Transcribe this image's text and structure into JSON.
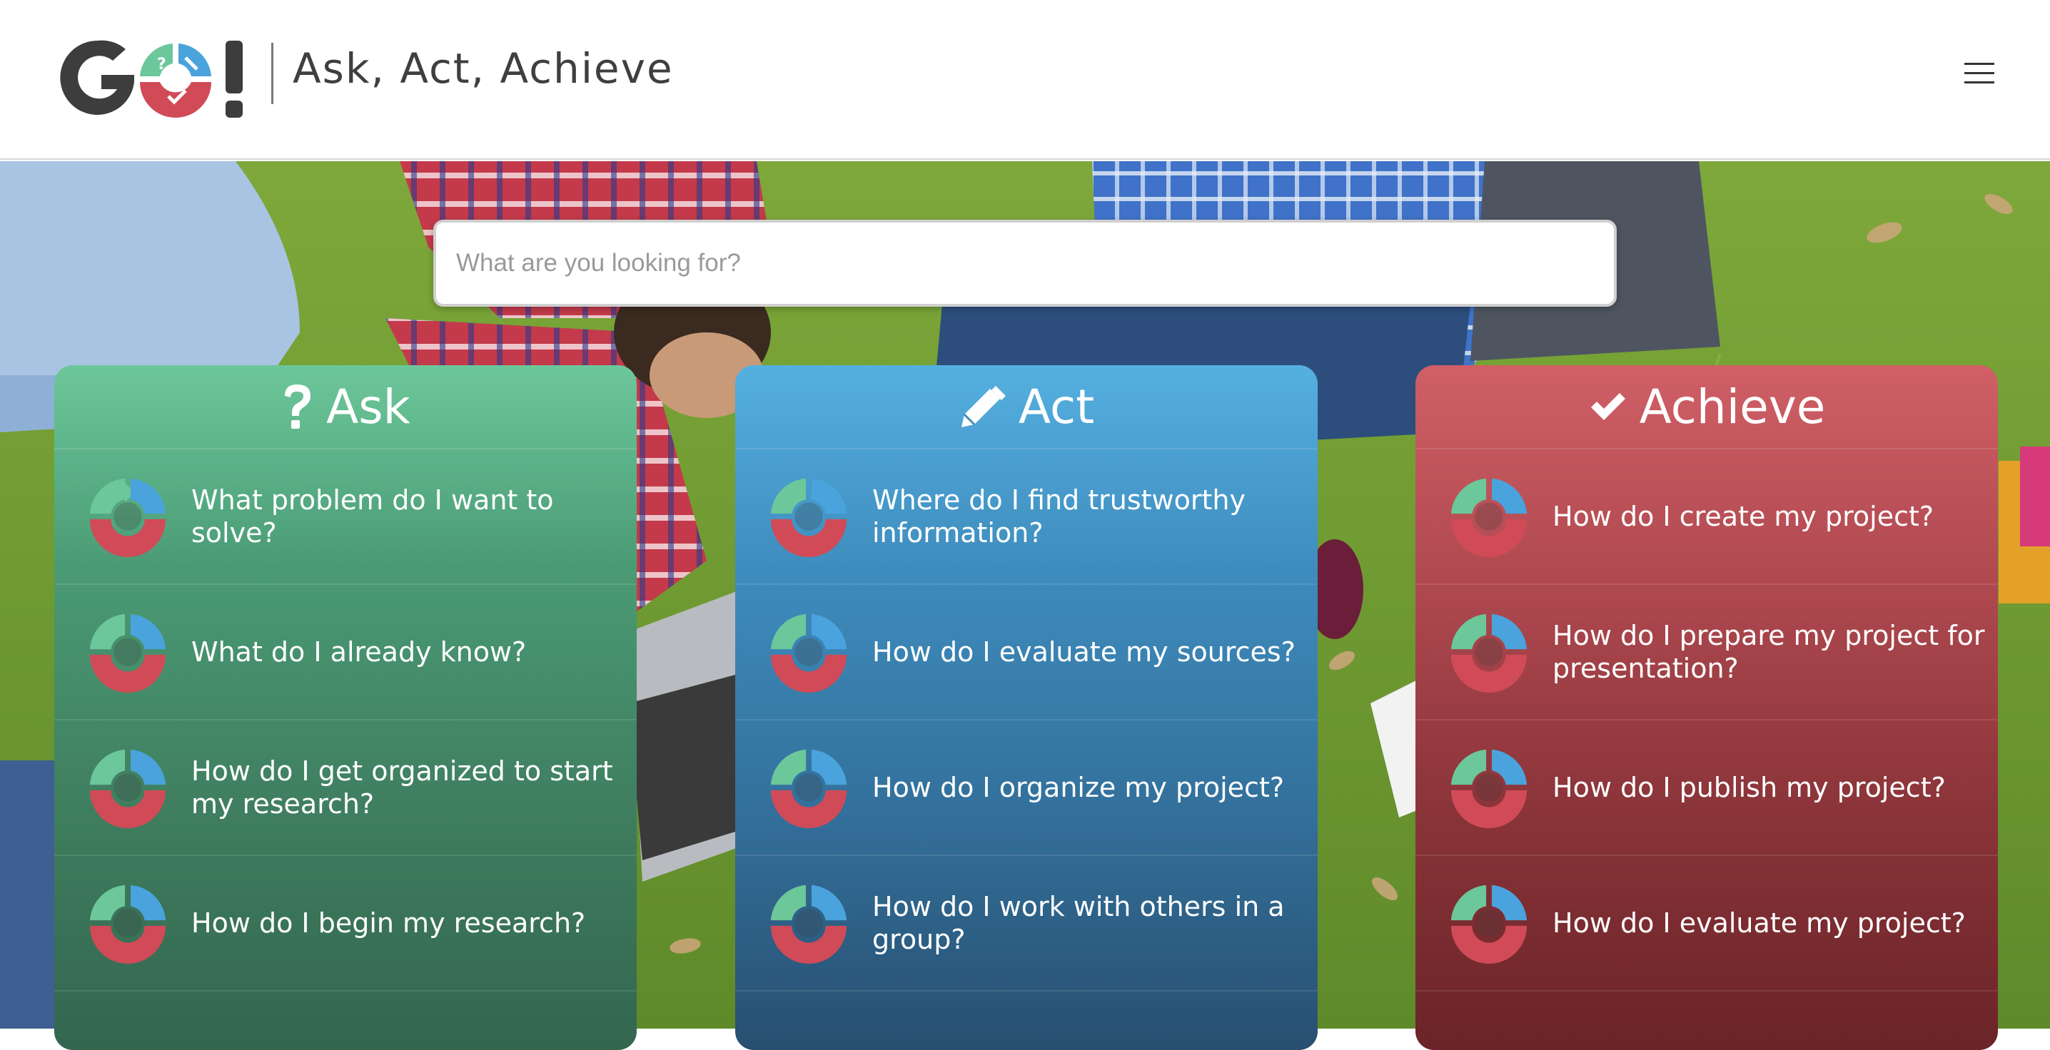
{
  "header": {
    "logo_text": "GO!",
    "tagline": "Ask, Act, Achieve",
    "menu_icon": "hamburger-icon"
  },
  "search": {
    "placeholder": "What are you looking for?",
    "value": ""
  },
  "columns": [
    {
      "title": "Ask",
      "icon": "question-mark-icon",
      "color": "#4a9a74",
      "items": [
        {
          "label": "What problem do I want to solve?"
        },
        {
          "label": "What do I already know?"
        },
        {
          "label": "How do I get organized to start my research?"
        },
        {
          "label": "How do I begin my research?"
        }
      ]
    },
    {
      "title": "Act",
      "icon": "pencil-icon",
      "color": "#3e8cbd",
      "items": [
        {
          "label": "Where do I find trustworthy information?"
        },
        {
          "label": "How do I evaluate my sources?"
        },
        {
          "label": "How do I organize my project?"
        },
        {
          "label": "How do I work with others in a group?"
        }
      ]
    },
    {
      "title": "Achieve",
      "icon": "checkmark-icon",
      "color": "#b14a51",
      "items": [
        {
          "label": "How do I create my project?"
        },
        {
          "label": "How do I prepare my project for presentation?"
        },
        {
          "label": "How do I publish my project?"
        },
        {
          "label": "How do I evaluate my project?"
        }
      ]
    }
  ],
  "colors": {
    "ask": "#4a9a74",
    "act": "#3e8cbd",
    "achieve": "#b14a51",
    "cycle_green": "#6cc79a",
    "cycle_blue": "#4aa3dc",
    "cycle_red": "#d04b57"
  }
}
